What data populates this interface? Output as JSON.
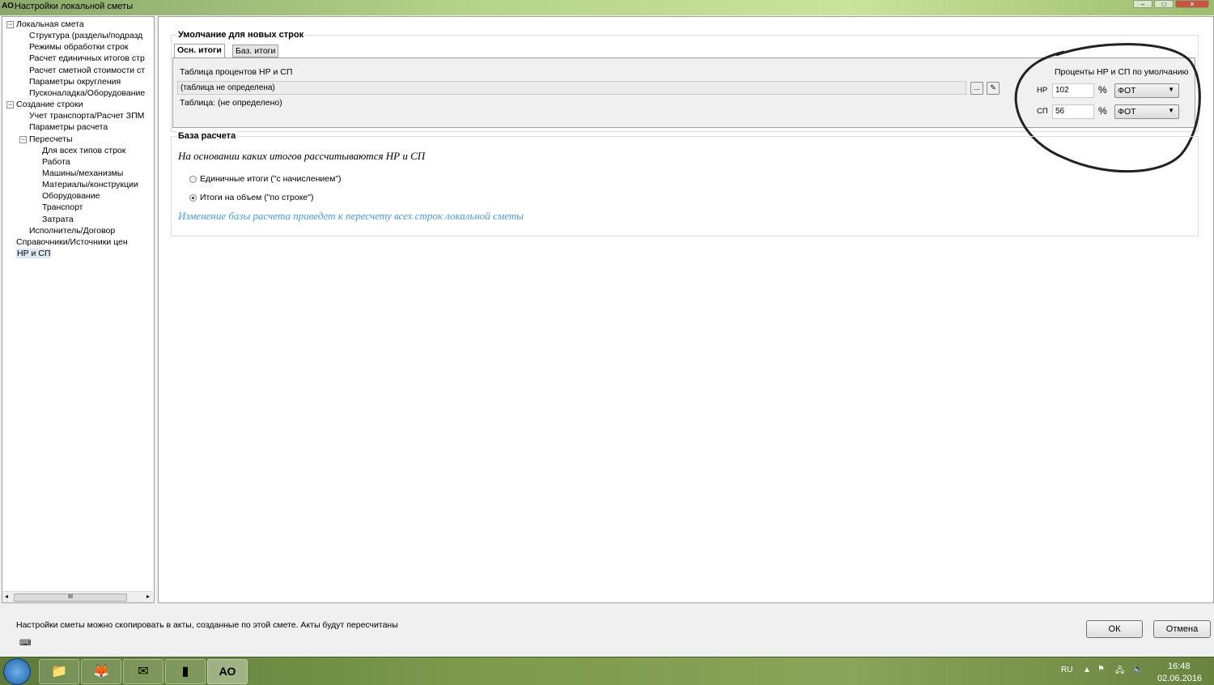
{
  "window": {
    "title": "Настройки локальной сметы",
    "app_icon": "АО",
    "controls": [
      "minimize",
      "maximize",
      "close"
    ]
  },
  "tree": {
    "items": [
      {
        "label": "Локальная смета",
        "level": 0,
        "expander": "⊟"
      },
      {
        "label": "Структура (разделы/подразд",
        "level": 1
      },
      {
        "label": "Режимы обработки строк",
        "level": 1
      },
      {
        "label": "Расчет единичных итогов стр",
        "level": 1
      },
      {
        "label": "Расчет сметной стоимости ст",
        "level": 1
      },
      {
        "label": "Параметры округления",
        "level": 1
      },
      {
        "label": "Пусконаладка/Оборудование",
        "level": 1
      },
      {
        "label": "Создание строки",
        "level": 0,
        "expander": "⊟"
      },
      {
        "label": "Учет транспорта/Расчет ЗПМ",
        "level": 1
      },
      {
        "label": "Параметры расчета",
        "level": 1
      },
      {
        "label": "Пересчеты",
        "level": 1,
        "expander": "⊟"
      },
      {
        "label": "Для всех типов строк",
        "level": 2
      },
      {
        "label": "Работа",
        "level": 2
      },
      {
        "label": "Машины/механизмы",
        "level": 2
      },
      {
        "label": "Материалы/конструкции",
        "level": 2
      },
      {
        "label": "Оборудование",
        "level": 2
      },
      {
        "label": "Транспорт",
        "level": 2
      },
      {
        "label": "Затрата",
        "level": 2
      },
      {
        "label": "Исполнитель/Договор",
        "level": 1
      },
      {
        "label": "Справочники/Источники цен",
        "level": 0
      },
      {
        "label": "НР и СП",
        "level": 0,
        "selected": true
      }
    ],
    "scroll_thumb": "III"
  },
  "defaults": {
    "group_title": "Умолчание для новых строк",
    "tabs": [
      {
        "label": "Осн. итоги",
        "active": true
      },
      {
        "label": "Баз. итоги",
        "active": false
      }
    ],
    "table_label": "Таблица процентов НР и СП",
    "table_value": "(таблица не определена)",
    "table_note": "Таблица: (не определено)",
    "browse_label": "...",
    "clear_icon": "eraser-icon",
    "percents_title": "Проценты НР и СП по умолчанию",
    "rows": [
      {
        "label": "НР",
        "value": "102",
        "unit": "%",
        "base": "ФОТ"
      },
      {
        "label": "СП",
        "value": "56",
        "unit": "%",
        "base": "ФОТ"
      }
    ]
  },
  "base": {
    "group_title": "База расчета",
    "question": "На основании каких итогов рассчитываются НР и СП",
    "options": [
      {
        "label": "Единичные итоги (\"с начислением\")",
        "selected": false
      },
      {
        "label": "Итоги на объем (\"по строке\")",
        "selected": true
      }
    ],
    "warning": "Изменение базы расчета приведет к пересчету всех строк локальной сметы"
  },
  "footer": {
    "note": "Настройки сметы можно скопировать в акты, созданные по этой смете. Акты будут пересчитаны",
    "ok": "ОК",
    "cancel": "Отмена"
  },
  "taskbar": {
    "apps": [
      "explorer",
      "firefox",
      "outlook",
      "app",
      "АО"
    ],
    "lang": "RU",
    "time": "16:48",
    "date": "02.06.2016"
  },
  "colors": {
    "warning_text": "#4a9ad4",
    "selection": "#dde8f3"
  }
}
